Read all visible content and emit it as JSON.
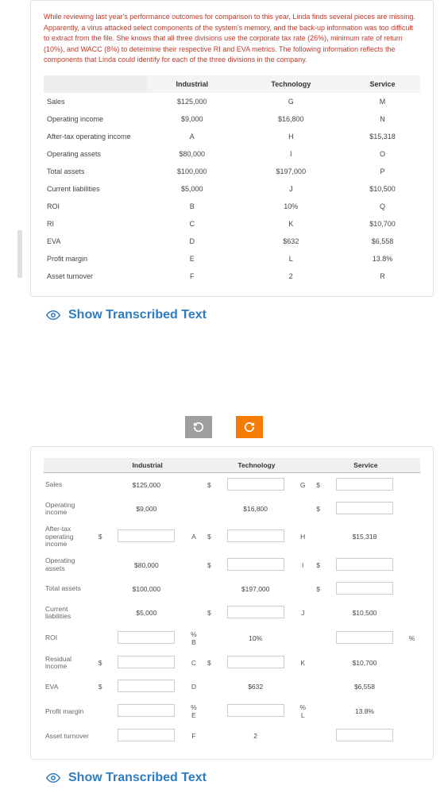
{
  "intro": "While reviewing last year's performance outcomes for comparison to this year, Linda finds several pieces are missing. Apparently, a virus attacked select components of the system's memory, and the back-up information was too difficult to extract from the file. She knows that all three divisions use the corporate tax rate (26%), minimum rate of return (10%), and WACC (8%) to determine their respective RI and EVA metrics. The following information reflects the components that Linda could identify for each of the three divisions in the company.",
  "headers": {
    "c1": "Industrial",
    "c2": "Technology",
    "c3": "Service"
  },
  "rows": [
    {
      "label": "Sales",
      "ind": "$125,000",
      "tech": "G",
      "serv": "M"
    },
    {
      "label": "Operating income",
      "ind": "$9,000",
      "tech": "$16,800",
      "serv": "N"
    },
    {
      "label": "After-tax operating income",
      "ind": "A",
      "tech": "H",
      "serv": "$15,318"
    },
    {
      "label": "Operating assets",
      "ind": "$80,000",
      "tech": "I",
      "serv": "O"
    },
    {
      "label": "Total assets",
      "ind": "$100,000",
      "tech": "$197,000",
      "serv": "P"
    },
    {
      "label": "Current liabilities",
      "ind": "$5,000",
      "tech": "J",
      "serv": "$10,500"
    },
    {
      "label": "ROI",
      "ind": "B",
      "tech": "10%",
      "serv": "Q"
    },
    {
      "label": "RI",
      "ind": "C",
      "tech": "K",
      "serv": "$10,700"
    },
    {
      "label": "EVA",
      "ind": "D",
      "tech": "$632",
      "serv": "$6,558"
    },
    {
      "label": "Profit margin",
      "ind": "E",
      "tech": "L",
      "serv": "13.8%"
    },
    {
      "label": "Asset turnover",
      "ind": "F",
      "tech": "2",
      "serv": "R"
    }
  ],
  "showText": "Show Transcribed Text",
  "t2rows": [
    {
      "label": "Sales",
      "ind_pre": "",
      "ind": "$125,000",
      "ind_post": "",
      "tech_pre": "$",
      "tech_input": true,
      "tech_post": "G",
      "serv_pre": "$",
      "serv_input": true,
      "serv_post": ""
    },
    {
      "label": "Operating income",
      "ind_pre": "",
      "ind": "$9,000",
      "ind_post": "",
      "tech_pre": "",
      "tech": "$16,800",
      "tech_post": "",
      "serv_pre": "$",
      "serv_input": true,
      "serv_post": ""
    },
    {
      "label": "After-tax operating income",
      "ind_pre": "$",
      "ind_input": true,
      "ind_post": "A",
      "tech_pre": "$",
      "tech_input": true,
      "tech_post": "H",
      "serv_pre": "",
      "serv": "$15,318",
      "serv_post": ""
    },
    {
      "label": "Operating assets",
      "ind_pre": "",
      "ind": "$80,000",
      "ind_post": "",
      "tech_pre": "$",
      "tech_input": true,
      "tech_post": "I",
      "serv_pre": "$",
      "serv_input": true,
      "serv_post": ""
    },
    {
      "label": "Total assets",
      "ind_pre": "",
      "ind": "$100,000",
      "ind_post": "",
      "tech_pre": "",
      "tech": "$197,000",
      "tech_post": "",
      "serv_pre": "$",
      "serv_input": true,
      "serv_post": ""
    },
    {
      "label": "Current liabilities",
      "ind_pre": "",
      "ind": "$5,000",
      "ind_post": "",
      "tech_pre": "$",
      "tech_input": true,
      "tech_post": "J",
      "serv_pre": "",
      "serv": "$10,500",
      "serv_post": ""
    },
    {
      "label": "ROI",
      "ind_pre": "",
      "ind_input": true,
      "ind_post": "%  B",
      "tech_pre": "",
      "tech": "10%",
      "tech_post": "",
      "serv_pre": "",
      "serv_input": true,
      "serv_post": "%"
    },
    {
      "label": "Residual income",
      "ind_pre": "$",
      "ind_input": true,
      "ind_post": "C",
      "tech_pre": "$",
      "tech_input": true,
      "tech_post": "K",
      "serv_pre": "",
      "serv": "$10,700",
      "serv_post": ""
    },
    {
      "label": "EVA",
      "ind_pre": "$",
      "ind_input": true,
      "ind_post": "D",
      "tech_pre": "",
      "tech": "$632",
      "tech_post": "",
      "serv_pre": "",
      "serv": "$6,558",
      "serv_post": ""
    },
    {
      "label": "Profit margin",
      "ind_pre": "",
      "ind_input": true,
      "ind_post": "%  E",
      "tech_pre": "",
      "tech_input": true,
      "tech_post": "%  L",
      "serv_pre": "",
      "serv": "13.8%",
      "serv_post": ""
    },
    {
      "label": "Asset turnover",
      "ind_pre": "",
      "ind_input": true,
      "ind_post": "F",
      "tech_pre": "",
      "tech": "2",
      "tech_post": "",
      "serv_pre": "",
      "serv_input": true,
      "serv_post": ""
    }
  ]
}
